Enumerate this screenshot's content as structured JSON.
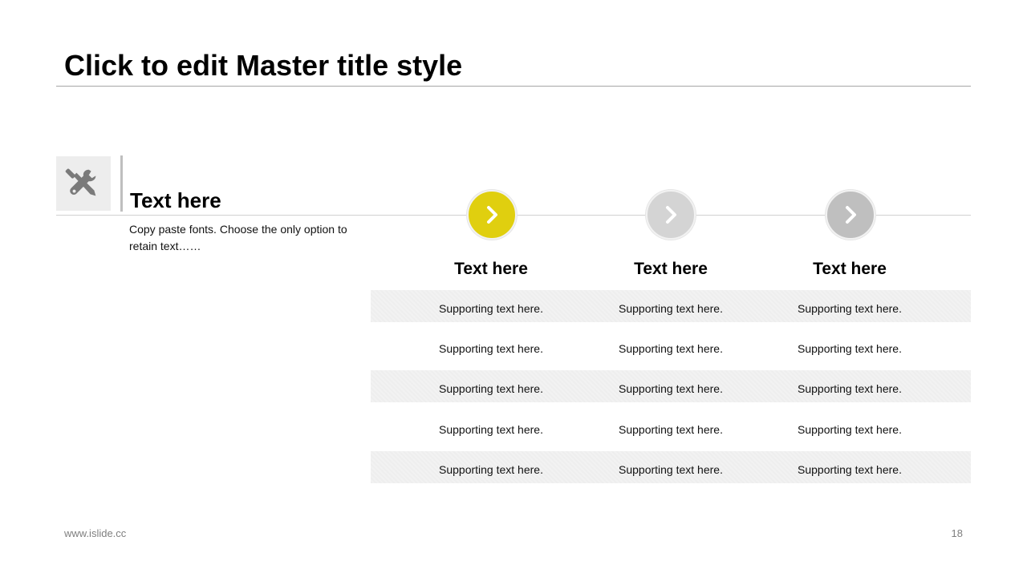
{
  "slide": {
    "title": "Click to edit Master title style",
    "footer_url": "www.islide.cc",
    "page_number": "18"
  },
  "left_panel": {
    "icon": "tools-icon",
    "heading": "Text here",
    "description": "Copy paste fonts. Choose the only option to retain text……"
  },
  "columns": [
    {
      "heading": "Text here",
      "icon": "chevron-right-icon",
      "color": "#e0cf0f"
    },
    {
      "heading": "Text here",
      "icon": "chevron-right-icon",
      "color": "#d4d4d4"
    },
    {
      "heading": "Text here",
      "icon": "chevron-right-icon",
      "color": "#bfbfbf"
    }
  ],
  "rows": [
    [
      "Supporting text here.",
      "Supporting text here.",
      "Supporting text here."
    ],
    [
      "Supporting text here.",
      "Supporting text here.",
      "Supporting text here."
    ],
    [
      "Supporting text here.",
      "Supporting text here.",
      "Supporting text here."
    ],
    [
      "Supporting text here.",
      "Supporting text here.",
      "Supporting text here."
    ],
    [
      "Supporting text here.",
      "Supporting text here.",
      "Supporting text here."
    ]
  ],
  "colors": {
    "accent": "#e0cf0f",
    "grey_light": "#d4d4d4",
    "grey_mid": "#bfbfbf",
    "icon_grey": "#7f7f7f"
  }
}
